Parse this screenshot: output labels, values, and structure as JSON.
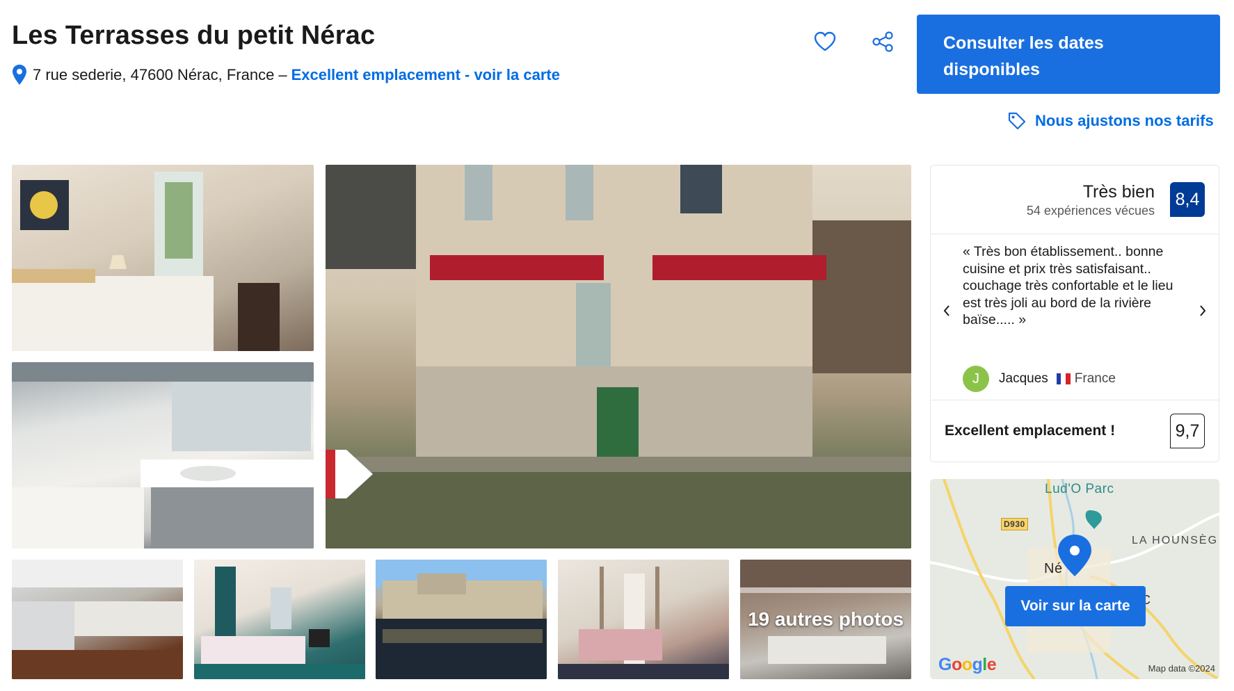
{
  "header": {
    "title": "Les Terrasses du petit Nérac",
    "address": "7 rue sederie, 47600 Nérac, France",
    "separator": "–",
    "location_link": "Excellent emplacement - voir la carte",
    "cta_label": "Consulter les dates disponibles",
    "price_note": "Nous ajustons nos tarifs",
    "icons": [
      "pin-icon",
      "heart-icon",
      "share-icon",
      "price-tag-icon"
    ]
  },
  "gallery": {
    "more_photos_label": "19 autres photos",
    "photos": [
      "bedroom",
      "bathroom",
      "building-facade",
      "kitchen",
      "bedroom",
      "river-view",
      "canopy-bed",
      "bathroom"
    ]
  },
  "review": {
    "score_word": "Très bien",
    "score_count": "54 expériences vécues",
    "score": "8,4",
    "quote": "« Très bon établissement.. bonne cuisine et prix très satisfaisant.. couchage très confortable et le lieu est très joli au bord de la rivière baïse..... »",
    "reviewer_initial": "J",
    "reviewer_name": "Jacques",
    "reviewer_country": "France",
    "location_label": "Excellent emplacement !",
    "location_score": "9,7"
  },
  "map": {
    "label_parc": "Lud'O Parc",
    "label_road": "D930",
    "label_area": "LA HOUNSÈG",
    "label_town": "Né",
    "label_c": "C",
    "button_label": "Voir sur la carte",
    "google_logo": "Google",
    "attribution": "Map data ©2024"
  },
  "colors": {
    "accent_blue": "#1a6fe0",
    "link_blue": "#006ce4",
    "score_navy": "#003b95",
    "avatar_green": "#8bc34a"
  }
}
